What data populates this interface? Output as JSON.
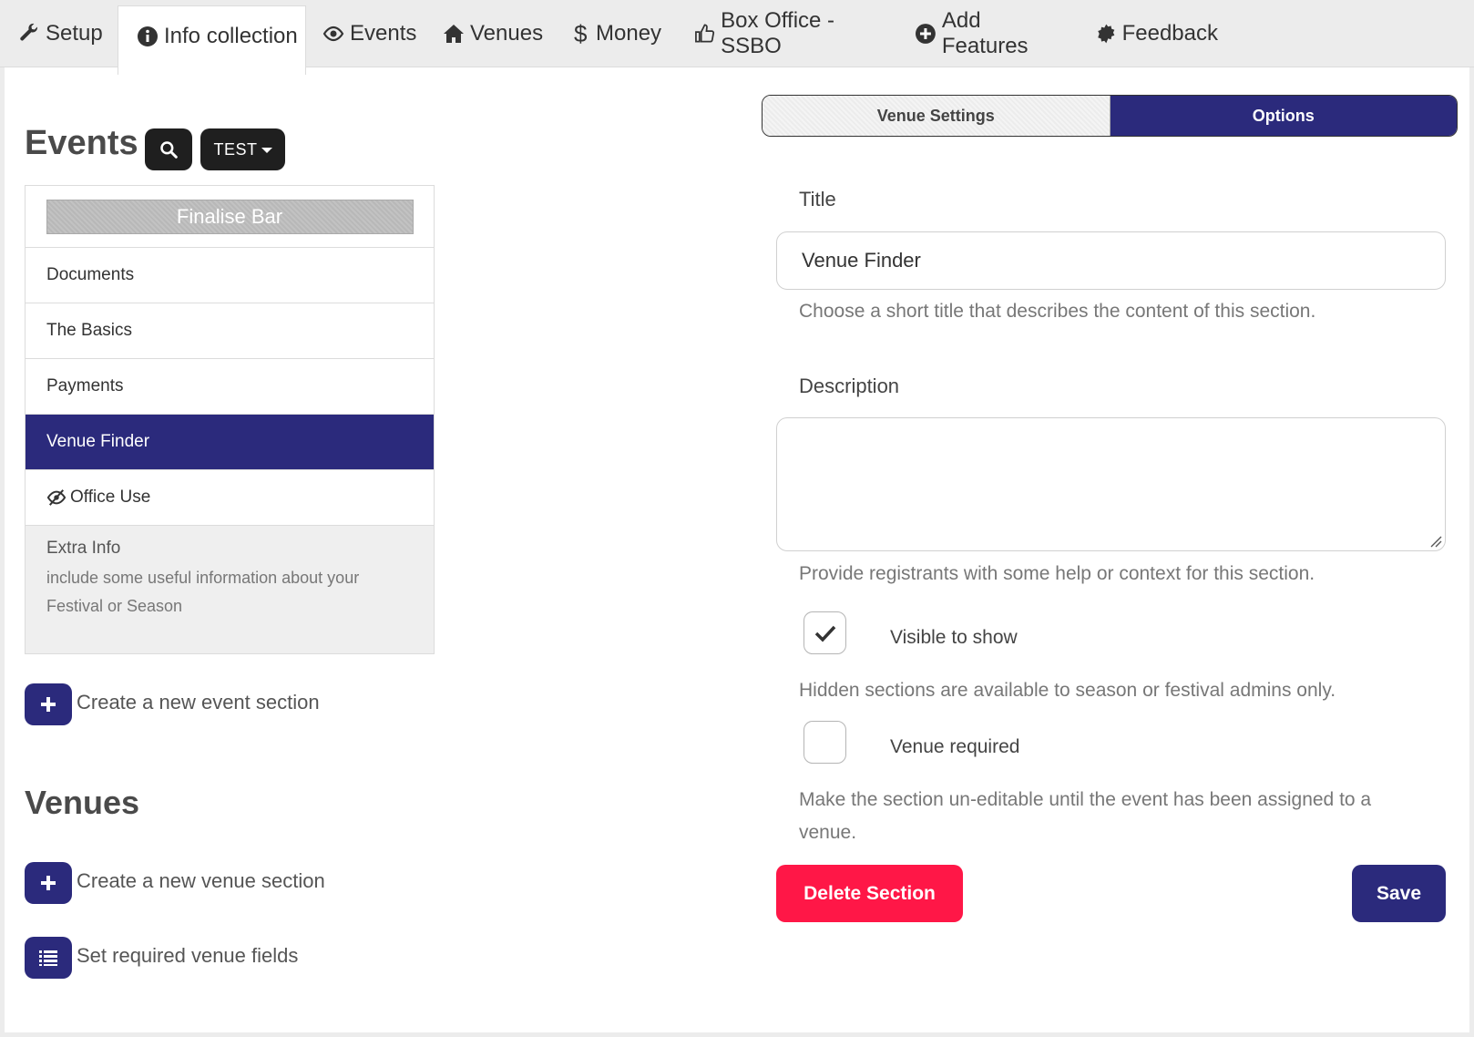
{
  "nav": {
    "tabs": [
      {
        "label": "Setup",
        "icon": "wrench-icon"
      },
      {
        "label": "Info collection",
        "icon": "info-circle-icon",
        "active": true
      },
      {
        "label": "Events",
        "icon": "eye-icon"
      },
      {
        "label": "Venues",
        "icon": "home-icon"
      },
      {
        "label": "Money",
        "icon": "dollar-icon"
      },
      {
        "label": "Box Office - SSBO",
        "icon": "thumbs-up-icon"
      },
      {
        "label": "Add Features",
        "icon": "plus-circle-icon"
      },
      {
        "label": "Feedback",
        "icon": "certificate-icon"
      }
    ]
  },
  "events": {
    "title": "Events",
    "filter_label": "TEST",
    "finalise_bar": "Finalise Bar",
    "items": [
      {
        "label": "Documents"
      },
      {
        "label": "The Basics"
      },
      {
        "label": "Payments"
      },
      {
        "label": "Venue Finder",
        "active": true
      },
      {
        "label": "Office Use",
        "icon": "eye-slash-icon"
      }
    ],
    "extra_info": {
      "title": "Extra Info",
      "description": "include some useful information about your Festival or Season"
    },
    "create_label": "Create a new event section"
  },
  "venues": {
    "title": "Venues",
    "create_label": "Create a new venue section",
    "required_label": "Set required venue fields"
  },
  "panel": {
    "tabs": {
      "venue_settings": "Venue Settings",
      "options": "Options"
    },
    "title_label": "Title",
    "title_value": "Venue Finder",
    "title_help": "Choose a short title that describes the content of this section.",
    "description_label": "Description",
    "description_value": "",
    "description_help": "Provide registrants with some help or context for this section.",
    "visible_label": "Visible to show",
    "visible_checked": true,
    "visible_help": "Hidden sections are available to season or festival admins only.",
    "venue_required_label": "Venue required",
    "venue_required_checked": false,
    "venue_required_help": "Make the section un-editable until the event has been assigned to a venue.",
    "delete_label": "Delete Section",
    "save_label": "Save"
  },
  "colors": {
    "primary": "#2b2a7c",
    "danger": "#ff1747",
    "dark": "#1f1f1f",
    "nav_bg": "#ececec"
  }
}
